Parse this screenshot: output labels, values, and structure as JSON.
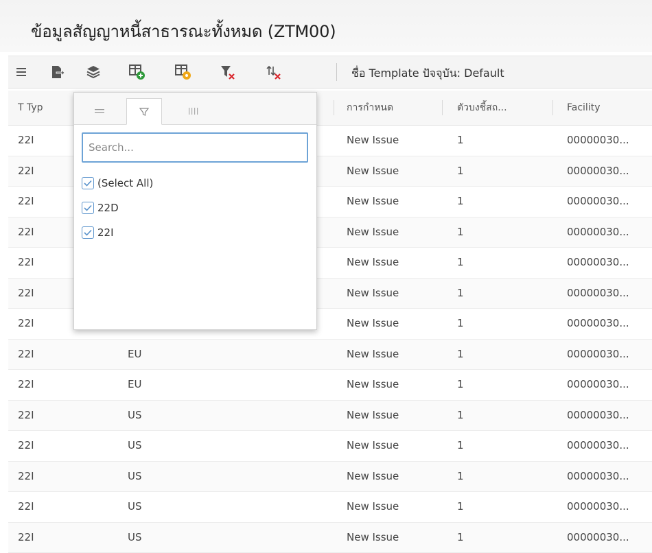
{
  "page": {
    "title": "ข้อมูลสัญญาหนี้สาธารณะทั้งหมด (ZTM00)"
  },
  "toolbar": {
    "buttons": [
      {
        "name": "list-icon"
      },
      {
        "name": "export-icon"
      },
      {
        "name": "layers-icon"
      },
      {
        "name": "add-template-icon"
      },
      {
        "name": "edit-template-icon"
      },
      {
        "name": "clear-filter-icon"
      },
      {
        "name": "clear-sort-icon"
      }
    ],
    "template_label": "ชื่อ Template ปัจจุบัน: Default"
  },
  "columns": [
    {
      "label": "T Typ"
    },
    {
      "label": "การกำหนด"
    },
    {
      "label": "ตัวบงชี้สถ..."
    },
    {
      "label": "Facility"
    }
  ],
  "rows": [
    {
      "type": "22I",
      "currency": "",
      "issue": "New Issue",
      "num": "1",
      "facility": "00000030..."
    },
    {
      "type": "22I",
      "currency": "",
      "issue": "New Issue",
      "num": "1",
      "facility": "00000030..."
    },
    {
      "type": "22I",
      "currency": "",
      "issue": "New Issue",
      "num": "1",
      "facility": "00000030..."
    },
    {
      "type": "22I",
      "currency": "",
      "issue": "New Issue",
      "num": "1",
      "facility": "00000030..."
    },
    {
      "type": "22I",
      "currency": "",
      "issue": "New Issue",
      "num": "1",
      "facility": "00000030..."
    },
    {
      "type": "22I",
      "currency": "",
      "issue": "New Issue",
      "num": "1",
      "facility": "00000030..."
    },
    {
      "type": "22I",
      "currency": "",
      "issue": "New Issue",
      "num": "1",
      "facility": "00000030..."
    },
    {
      "type": "22I",
      "currency": "EU",
      "issue": "New Issue",
      "num": "1",
      "facility": "00000030..."
    },
    {
      "type": "22I",
      "currency": "EU",
      "issue": "New Issue",
      "num": "1",
      "facility": "00000030..."
    },
    {
      "type": "22I",
      "currency": "US",
      "issue": "New Issue",
      "num": "1",
      "facility": "00000030..."
    },
    {
      "type": "22I",
      "currency": "US",
      "issue": "New Issue",
      "num": "1",
      "facility": "00000030..."
    },
    {
      "type": "22I",
      "currency": "US",
      "issue": "New Issue",
      "num": "1",
      "facility": "00000030..."
    },
    {
      "type": "22I",
      "currency": "US",
      "issue": "New Issue",
      "num": "1",
      "facility": "00000030..."
    },
    {
      "type": "22I",
      "currency": "US",
      "issue": "New Issue",
      "num": "1",
      "facility": "00000030..."
    }
  ],
  "filter_popup": {
    "tabs": [
      {
        "name": "menu-icon"
      },
      {
        "name": "filter-icon",
        "active": true
      },
      {
        "name": "columns-icon"
      }
    ],
    "search_placeholder": "Search...",
    "options": [
      {
        "label": "(Select All)",
        "checked": true
      },
      {
        "label": "22D",
        "checked": true
      },
      {
        "label": "22I",
        "checked": true
      }
    ]
  },
  "colors": {
    "accent_blue": "#5a93cc",
    "green": "#2e9a3a",
    "orange": "#f0a818",
    "red": "#d9232a"
  }
}
